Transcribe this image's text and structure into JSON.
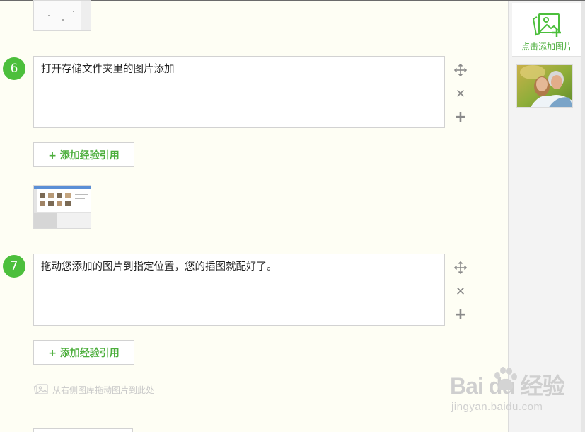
{
  "steps": [
    {
      "number": "6",
      "text": "打开存储文件夹里的图片添加"
    },
    {
      "number": "7",
      "text": "拖动您添加的图片到指定位置，您的插图就配好了。"
    }
  ],
  "add_ref_label": "+ 添加经验引用",
  "drag_hint": "从右侧图库拖动图片到此处",
  "sidebar": {
    "upload_label": "点击添加图片"
  },
  "icons": {
    "move": "move-icon",
    "delete": "close-icon",
    "add": "plus-icon",
    "upload": "add-image-icon",
    "drag_hint": "image-icon"
  },
  "colors": {
    "accent": "#4cbf3c",
    "link_green": "#4cae3c",
    "background": "#fefef4"
  },
  "watermark": {
    "brand": "Bai du 经验",
    "url": "jingyan.baidu.com"
  }
}
